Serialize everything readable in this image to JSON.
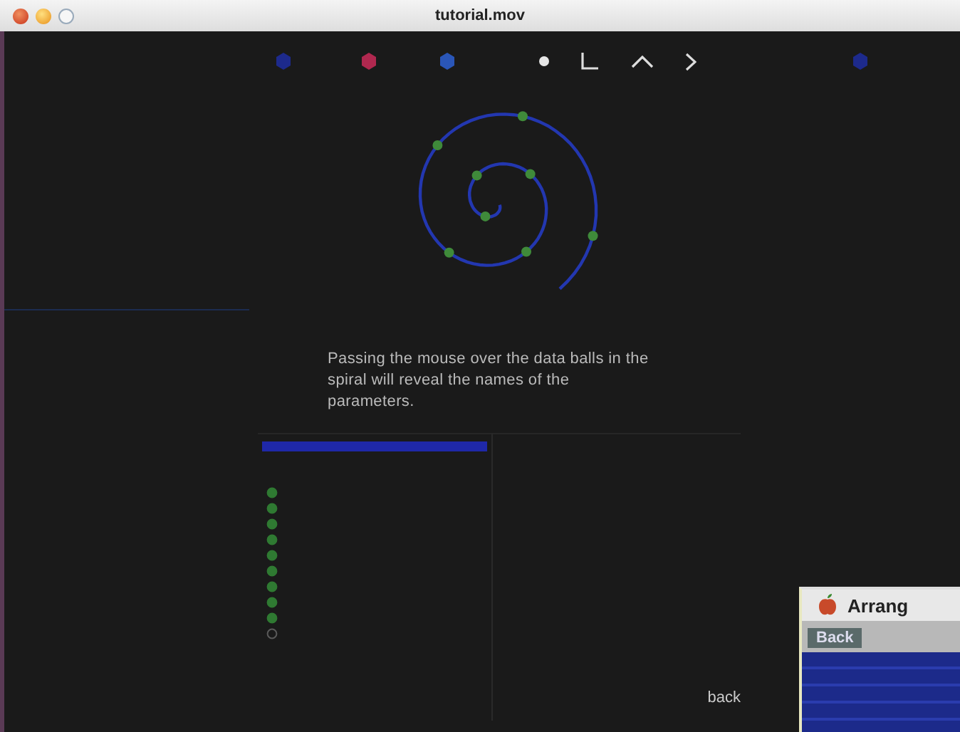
{
  "window": {
    "title": "tutorial.mov"
  },
  "toolbar_markers": [
    {
      "kind": "hexagon",
      "color": "#1d2a8c"
    },
    {
      "kind": "hexagon",
      "color": "#b0284f"
    },
    {
      "kind": "hexagon",
      "color": "#2a56b8"
    },
    {
      "kind": "dot"
    },
    {
      "kind": "corner"
    },
    {
      "kind": "caret-up"
    },
    {
      "kind": "chevron-right"
    },
    {
      "kind": "hexagon",
      "color": "#1d2a8c"
    }
  ],
  "caption": "Passing the mouse over the data balls in the spiral will reveal the names of the parameters.",
  "list_items": [
    {
      "on": true
    },
    {
      "on": true
    },
    {
      "on": true
    },
    {
      "on": true
    },
    {
      "on": true
    },
    {
      "on": true
    },
    {
      "on": true
    },
    {
      "on": true
    },
    {
      "on": true
    },
    {
      "on": false
    }
  ],
  "back_link": "back",
  "inset_window": {
    "title": "Arrang",
    "tab": "Back"
  }
}
